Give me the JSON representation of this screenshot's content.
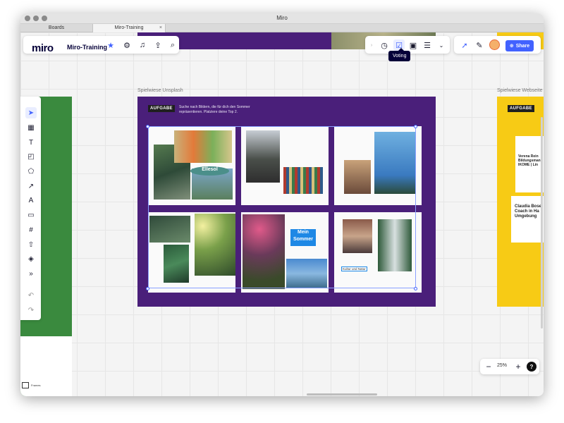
{
  "window": {
    "title": "Miro"
  },
  "tabs": [
    {
      "label": "Boards"
    },
    {
      "label": "Miro-Training"
    }
  ],
  "header": {
    "logo": "miro",
    "board_name": "Miro-Training",
    "star_icon": "star-icon",
    "icons": [
      "settings-icon",
      "bell-icon",
      "export-icon",
      "search-icon"
    ]
  },
  "collab": {
    "icons": [
      "timer-icon",
      "voting-icon",
      "presentation-icon",
      "notes-icon",
      "more-chevron-icon"
    ],
    "share_label": "Share",
    "tooltip": "Voting"
  },
  "frames": {
    "unsplash_label": "Spielwiese Unsplash",
    "web_label": "Spielwiese Webseite",
    "task_tag": "AUFGABE",
    "task_text": "Suche nach Bildern, die für dich den Sommer repräsentieren. Platziere deine Top 2.",
    "yellow_tag": "AUFGABE",
    "web_card1_title": "Verena Rein Bildungsman IKOME | Lin",
    "web_card2_title": "Claudia Bose Coach in Ha Umgebung"
  },
  "moodboard": {
    "sticker_ellesol": "Ellesol",
    "sticker_mein_sommer": "Mein Sommer",
    "label_kultur": "Kultur und Natur"
  },
  "toolbar": {
    "tools": [
      "cursor-icon",
      "template-icon",
      "text-icon",
      "sticky-note-icon",
      "shapes-icon",
      "arrow-icon",
      "pen-icon",
      "comment-icon",
      "frame-icon",
      "upload-icon",
      "apps-icon",
      "more-tools-icon",
      "undo-icon",
      "redo-icon"
    ]
  },
  "bottom": {
    "frames_label": "Frames"
  },
  "zoom": {
    "level": "25%",
    "minus": "−",
    "plus": "+",
    "help": "?"
  },
  "colors": {
    "purple_frame": "#4a1f7a",
    "yellow_frame": "#f7cb15",
    "green_frame": "#3a8a3e",
    "accent": "#4262ff"
  }
}
